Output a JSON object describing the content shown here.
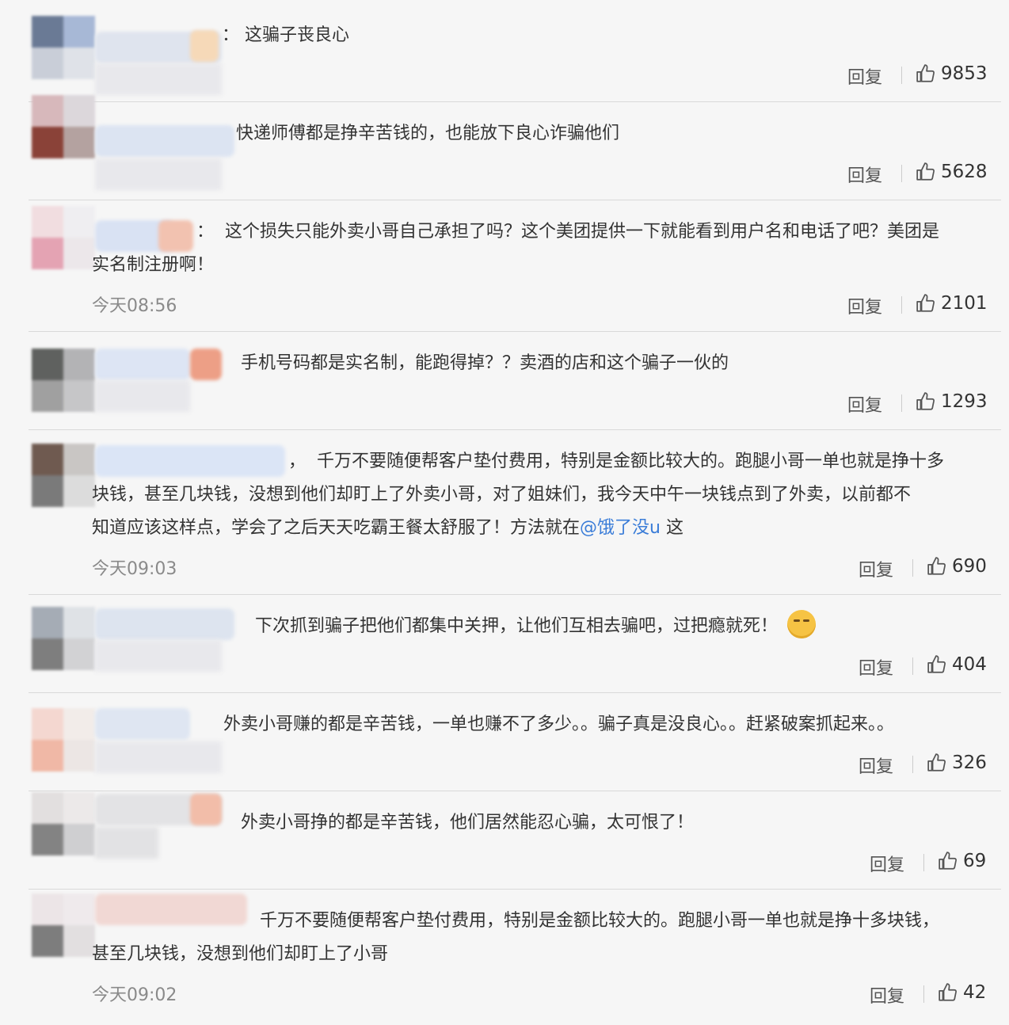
{
  "comments": [
    {
      "text": "这骗子丧良心",
      "time": "",
      "reply": "回复",
      "likes": "9853"
    },
    {
      "text": "快递师傅都是挣辛苦钱的，也能放下良心诈骗他们",
      "time": "",
      "reply": "回复",
      "likes": "5628"
    },
    {
      "text_line1": "这个损失只能外卖小哥自己承担了吗？这个美团提供一下就能看到用户名和电话了吧？美团是",
      "text_line2": "实名制注册啊！",
      "time": "今天08:56",
      "reply": "回复",
      "likes": "2101"
    },
    {
      "text": "手机号码都是实名制，能跑得掉？？卖酒的店和这个骗子一伙的",
      "time": "",
      "reply": "回复",
      "likes": "1293"
    },
    {
      "text_line1": "千万不要随便帮客户垫付费用，特别是金额比较大的。跑腿小哥一单也就是挣十多",
      "text_line2": "块钱，甚至几块钱，没想到他们却盯上了外卖小哥，对了姐妹们，我今天中午一块钱点到了外卖，以前都不",
      "text_line3_a": "知道应该这样点，学会了之后天天吃霸王餐太舒服了！方法就在",
      "mention": "@饿了没u",
      "text_line3_b": " 这",
      "time": "今天09:03",
      "reply": "回复",
      "likes": "690"
    },
    {
      "text": "下次抓到骗子把他们都集中关押，让他们互相去骗吧，过把瘾就死！",
      "emoji": "shushing-face-emoji",
      "time": "",
      "reply": "回复",
      "likes": "404"
    },
    {
      "text": "外卖小哥赚的都是辛苦钱，一单也赚不了多少。。骗子真是没良心。。赶紧破案抓起来。。",
      "time": "",
      "reply": "回复",
      "likes": "326"
    },
    {
      "text": "外卖小哥挣的都是辛苦钱，他们居然能忍心骗，太可恨了！",
      "time": "",
      "reply": "回复",
      "likes": "69"
    },
    {
      "text_line1": "千万不要随便帮客户垫付费用，特别是金额比较大的。跑腿小哥一单也就是挣十多块钱，",
      "text_line2": "甚至几块钱，没想到他们却盯上了小哥",
      "time": "今天09:02",
      "reply": "回复",
      "likes": "42"
    }
  ],
  "icons": {
    "like": "thumbs-up-icon"
  },
  "colors": {
    "mention": "#3b7dd8",
    "background": "#f6f6f6",
    "divider": "#d9d9d9"
  }
}
